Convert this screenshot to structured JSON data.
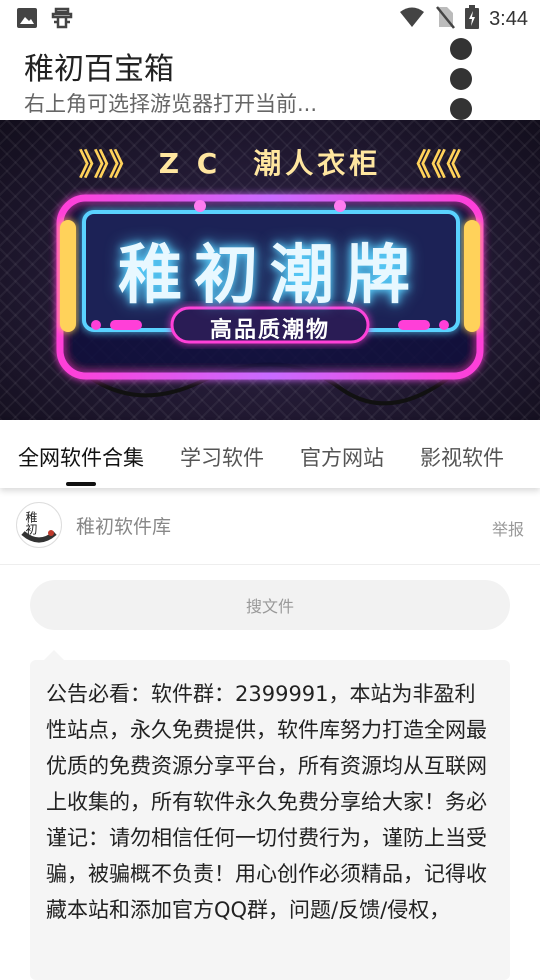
{
  "status_bar": {
    "time": "3:44",
    "icons": [
      "image-icon",
      "bug-icon",
      "wifi-icon",
      "no-sim-icon",
      "battery-icon"
    ]
  },
  "header": {
    "title": "稚初百宝箱",
    "subtitle": "右上角可选择游览器打开当前..."
  },
  "banner": {
    "top_line_left": "》》》",
    "top_line": "Z C　潮人衣柜",
    "top_line_right": "《《《",
    "sign_text": "稚初潮牌",
    "sign_subtext": "高品质潮物",
    "colors": {
      "neon_pink": "#ff3fd8",
      "neon_blue": "#5ad2ff",
      "neon_yellow": "#ffd25a"
    }
  },
  "tabs": [
    {
      "label": "全网软件合集",
      "active": true
    },
    {
      "label": "学习软件",
      "active": false
    },
    {
      "label": "官方网站",
      "active": false
    },
    {
      "label": "影视软件",
      "active": false
    }
  ],
  "author": {
    "avatar_text": "稚初",
    "name": "稚初软件库",
    "report_label": "举报"
  },
  "search": {
    "placeholder": "搜文件"
  },
  "notice": {
    "text": "公告必看：软件群：2399991，本站为非盈利性站点，永久免费提供，软件库努力打造全网最优质的免费资源分享平台，所有资源均从互联网上收集的，所有软件永久免费分享给大家！务必谨记：请勿相信任何一切付费行为，谨防上当受骗，被骗概不负责！用心创作必须精品，记得收藏本站和添加官方QQ群，问题/反馈/侵权，"
  }
}
